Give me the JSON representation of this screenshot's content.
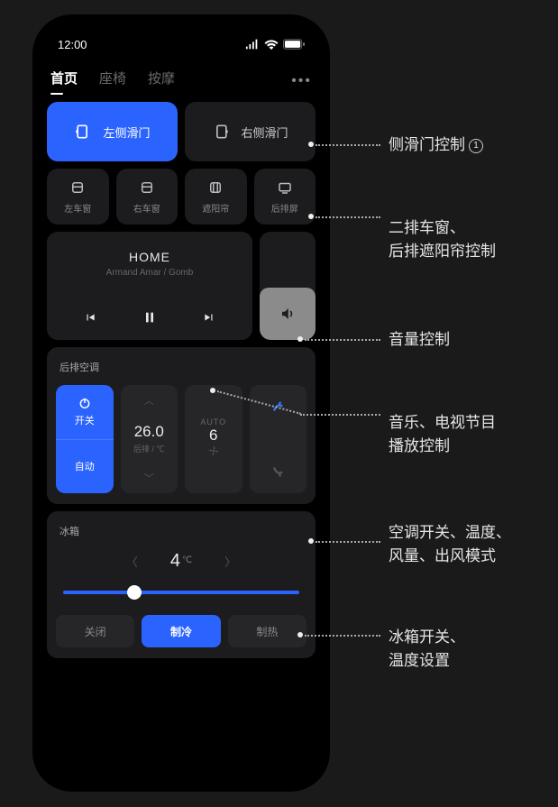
{
  "statusBar": {
    "time": "12:00"
  },
  "tabs": {
    "items": [
      {
        "label": "首页",
        "active": true
      },
      {
        "label": "座椅",
        "active": false
      },
      {
        "label": "按摩",
        "active": false
      }
    ],
    "more": "•••"
  },
  "doors": {
    "left": "左侧滑门",
    "right": "右侧滑门"
  },
  "quick": {
    "items": [
      {
        "label": "左车窗",
        "name": "left-window-button"
      },
      {
        "label": "右车窗",
        "name": "right-window-button"
      },
      {
        "label": "遮阳帘",
        "name": "sunshade-button"
      },
      {
        "label": "后排屏",
        "name": "rear-screen-button"
      }
    ]
  },
  "music": {
    "title": "HOME",
    "artist": "Armand Amar / Gomb"
  },
  "ac": {
    "title": "后排空调",
    "switch": {
      "power": "开关",
      "auto": "自动"
    },
    "temp": {
      "value": "26.0",
      "sub": "后排 / ℃"
    },
    "fan": {
      "auto": "AUTO",
      "value": "6"
    }
  },
  "fridge": {
    "title": "冰箱",
    "temp": "4",
    "unit": "℃",
    "modes": {
      "off": "关闭",
      "cool": "制冷",
      "heat": "制热"
    }
  },
  "annotations": {
    "a1": {
      "text1": "侧滑门控制",
      "num": "1"
    },
    "a2": {
      "text1": "二排车窗、",
      "text2": "后排遮阳帘控制"
    },
    "a3": {
      "text1": "音量控制"
    },
    "a4": {
      "text1": "音乐、电视节目",
      "text2": "播放控制"
    },
    "a5": {
      "text1": "空调开关、温度、",
      "text2": "风量、出风模式"
    },
    "a6": {
      "text1": "冰箱开关、",
      "text2": "温度设置"
    }
  }
}
